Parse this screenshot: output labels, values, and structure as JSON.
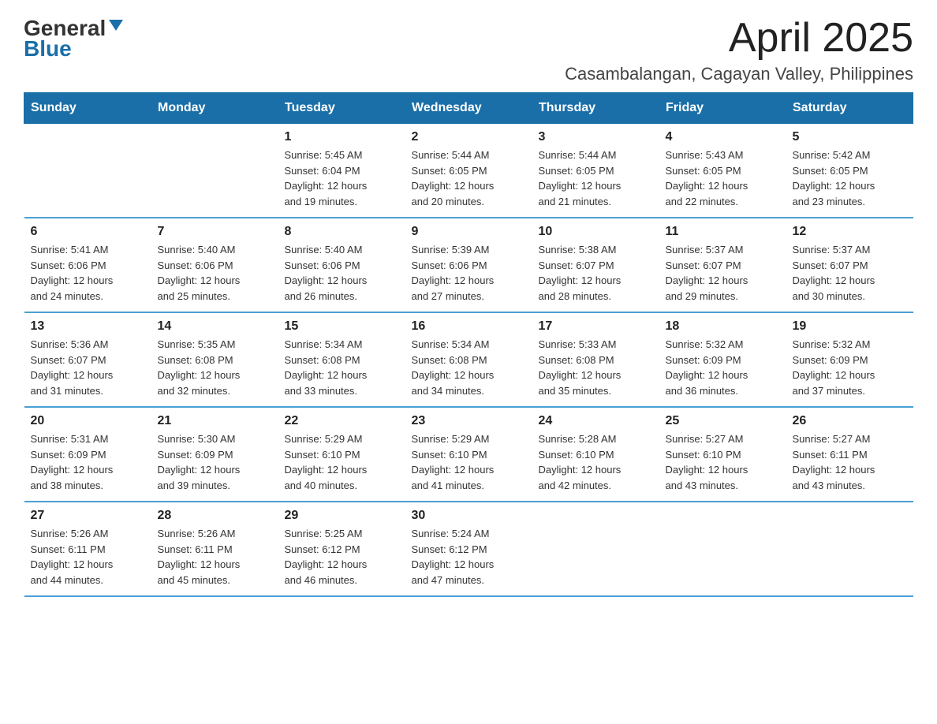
{
  "header": {
    "logo_general": "General",
    "logo_blue": "Blue",
    "month_title": "April 2025",
    "location": "Casambalangan, Cagayan Valley, Philippines"
  },
  "days_of_week": [
    "Sunday",
    "Monday",
    "Tuesday",
    "Wednesday",
    "Thursday",
    "Friday",
    "Saturday"
  ],
  "weeks": [
    [
      {
        "day": "",
        "info": ""
      },
      {
        "day": "",
        "info": ""
      },
      {
        "day": "1",
        "info": "Sunrise: 5:45 AM\nSunset: 6:04 PM\nDaylight: 12 hours\nand 19 minutes."
      },
      {
        "day": "2",
        "info": "Sunrise: 5:44 AM\nSunset: 6:05 PM\nDaylight: 12 hours\nand 20 minutes."
      },
      {
        "day": "3",
        "info": "Sunrise: 5:44 AM\nSunset: 6:05 PM\nDaylight: 12 hours\nand 21 minutes."
      },
      {
        "day": "4",
        "info": "Sunrise: 5:43 AM\nSunset: 6:05 PM\nDaylight: 12 hours\nand 22 minutes."
      },
      {
        "day": "5",
        "info": "Sunrise: 5:42 AM\nSunset: 6:05 PM\nDaylight: 12 hours\nand 23 minutes."
      }
    ],
    [
      {
        "day": "6",
        "info": "Sunrise: 5:41 AM\nSunset: 6:06 PM\nDaylight: 12 hours\nand 24 minutes."
      },
      {
        "day": "7",
        "info": "Sunrise: 5:40 AM\nSunset: 6:06 PM\nDaylight: 12 hours\nand 25 minutes."
      },
      {
        "day": "8",
        "info": "Sunrise: 5:40 AM\nSunset: 6:06 PM\nDaylight: 12 hours\nand 26 minutes."
      },
      {
        "day": "9",
        "info": "Sunrise: 5:39 AM\nSunset: 6:06 PM\nDaylight: 12 hours\nand 27 minutes."
      },
      {
        "day": "10",
        "info": "Sunrise: 5:38 AM\nSunset: 6:07 PM\nDaylight: 12 hours\nand 28 minutes."
      },
      {
        "day": "11",
        "info": "Sunrise: 5:37 AM\nSunset: 6:07 PM\nDaylight: 12 hours\nand 29 minutes."
      },
      {
        "day": "12",
        "info": "Sunrise: 5:37 AM\nSunset: 6:07 PM\nDaylight: 12 hours\nand 30 minutes."
      }
    ],
    [
      {
        "day": "13",
        "info": "Sunrise: 5:36 AM\nSunset: 6:07 PM\nDaylight: 12 hours\nand 31 minutes."
      },
      {
        "day": "14",
        "info": "Sunrise: 5:35 AM\nSunset: 6:08 PM\nDaylight: 12 hours\nand 32 minutes."
      },
      {
        "day": "15",
        "info": "Sunrise: 5:34 AM\nSunset: 6:08 PM\nDaylight: 12 hours\nand 33 minutes."
      },
      {
        "day": "16",
        "info": "Sunrise: 5:34 AM\nSunset: 6:08 PM\nDaylight: 12 hours\nand 34 minutes."
      },
      {
        "day": "17",
        "info": "Sunrise: 5:33 AM\nSunset: 6:08 PM\nDaylight: 12 hours\nand 35 minutes."
      },
      {
        "day": "18",
        "info": "Sunrise: 5:32 AM\nSunset: 6:09 PM\nDaylight: 12 hours\nand 36 minutes."
      },
      {
        "day": "19",
        "info": "Sunrise: 5:32 AM\nSunset: 6:09 PM\nDaylight: 12 hours\nand 37 minutes."
      }
    ],
    [
      {
        "day": "20",
        "info": "Sunrise: 5:31 AM\nSunset: 6:09 PM\nDaylight: 12 hours\nand 38 minutes."
      },
      {
        "day": "21",
        "info": "Sunrise: 5:30 AM\nSunset: 6:09 PM\nDaylight: 12 hours\nand 39 minutes."
      },
      {
        "day": "22",
        "info": "Sunrise: 5:29 AM\nSunset: 6:10 PM\nDaylight: 12 hours\nand 40 minutes."
      },
      {
        "day": "23",
        "info": "Sunrise: 5:29 AM\nSunset: 6:10 PM\nDaylight: 12 hours\nand 41 minutes."
      },
      {
        "day": "24",
        "info": "Sunrise: 5:28 AM\nSunset: 6:10 PM\nDaylight: 12 hours\nand 42 minutes."
      },
      {
        "day": "25",
        "info": "Sunrise: 5:27 AM\nSunset: 6:10 PM\nDaylight: 12 hours\nand 43 minutes."
      },
      {
        "day": "26",
        "info": "Sunrise: 5:27 AM\nSunset: 6:11 PM\nDaylight: 12 hours\nand 43 minutes."
      }
    ],
    [
      {
        "day": "27",
        "info": "Sunrise: 5:26 AM\nSunset: 6:11 PM\nDaylight: 12 hours\nand 44 minutes."
      },
      {
        "day": "28",
        "info": "Sunrise: 5:26 AM\nSunset: 6:11 PM\nDaylight: 12 hours\nand 45 minutes."
      },
      {
        "day": "29",
        "info": "Sunrise: 5:25 AM\nSunset: 6:12 PM\nDaylight: 12 hours\nand 46 minutes."
      },
      {
        "day": "30",
        "info": "Sunrise: 5:24 AM\nSunset: 6:12 PM\nDaylight: 12 hours\nand 47 minutes."
      },
      {
        "day": "",
        "info": ""
      },
      {
        "day": "",
        "info": ""
      },
      {
        "day": "",
        "info": ""
      }
    ]
  ]
}
